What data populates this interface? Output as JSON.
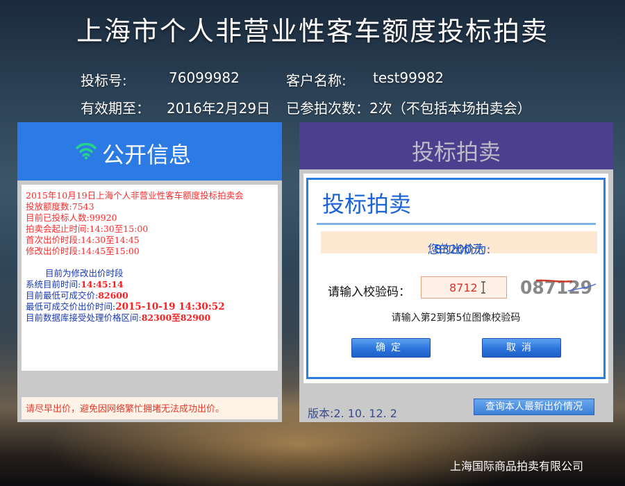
{
  "title": "上海市个人非营业性客车额度投标拍卖",
  "header": {
    "bid_no_label": "投标号:",
    "bid_no": "76099982",
    "client_label": "客户名称:",
    "client_name": "test99982",
    "valid_label": "有效期至：",
    "valid_date": "2016年2月29日",
    "attended_text": "已参拍次数：2次（不包括本场拍卖会）"
  },
  "left_panel": {
    "title": "公开信息",
    "lines": [
      "2015年10月19日上海个人非营业性客车额度投标拍卖会",
      "投放额度数:7543",
      "目前已投标人数:99920",
      "拍卖会起止时间:14:30至15:00",
      "首次出价时段:14:30至14:45",
      "修改出价时段:14:45至15:00"
    ],
    "phase": "目前为修改出价时段",
    "sys_time_label": "系统目前时间:",
    "sys_time": "14:45:14",
    "min_price_label": "目前最低可成交价:",
    "min_price": "82600",
    "min_price_time_label": "最低可成交价出价时间:",
    "min_price_time": "2015-10-19 14:30:52",
    "range_label": "目前数据库接受处理价格区间:",
    "range": "82300至82900",
    "footer": "请尽早出价，避免因网络繁忙拥堵无法成功出价。"
  },
  "right_panel": {
    "title": "投标拍卖",
    "dialog_title": "投标拍卖",
    "bid_label": "您的出价为:",
    "bid_value": "83200元",
    "captcha_label": "请输入校验码：",
    "captcha_value": "8712",
    "captcha_image": "087129",
    "hint": "请输入第2到第5位图像校验码",
    "confirm": "确定",
    "cancel": "取消",
    "version": "版本:2. 10. 12. 2",
    "query": "查询本人最新出价情况"
  },
  "company": "上海国际商品拍卖有限公司",
  "colors": {
    "left_header": "#2c7be4",
    "right_header": "#4b3f8e",
    "dialog_border": "#2b7ee0",
    "info_red": "#ff2a2a",
    "info_blue": "#1838b8"
  }
}
